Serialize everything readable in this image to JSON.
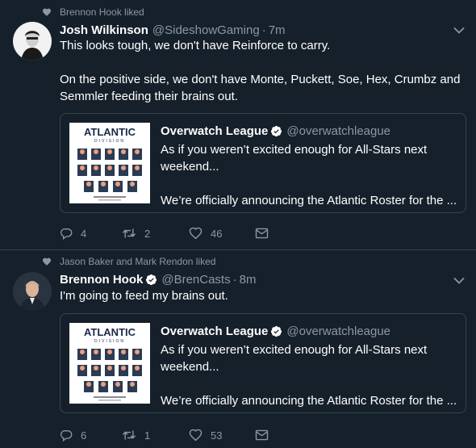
{
  "tweets": [
    {
      "social_context": "Brennon Hook liked",
      "author": {
        "display_name": "Josh Wilkinson",
        "handle": "@SideshowGaming",
        "verified": false
      },
      "time": "7m",
      "text": [
        "This looks tough, we don't have Reinforce to carry.",
        "On the positive side, we don't have Monte, Puckett, Soe, Hex, Crumbz and Semmler feeding their brains out."
      ],
      "quote": {
        "display_name": "Overwatch League",
        "handle": "@overwatchleague",
        "verified": true,
        "text": [
          "As if you weren’t excited enough for All-Stars next weekend...",
          "We’re officially announcing the Atlantic Roster for the ..."
        ],
        "thumbnail": {
          "title": "ATLANTIC",
          "subtitle": "DIVISION"
        }
      },
      "actions": {
        "replies": "4",
        "retweets": "2",
        "likes": "46"
      }
    },
    {
      "social_context": "Jason Baker and Mark Rendon liked",
      "author": {
        "display_name": "Brennon Hook",
        "handle": "@BrenCasts",
        "verified": true
      },
      "time": "8m",
      "text": [
        "I'm going to feed my brains out."
      ],
      "quote": {
        "display_name": "Overwatch League",
        "handle": "@overwatchleague",
        "verified": true,
        "text": [
          "As if you weren’t excited enough for All-Stars next weekend...",
          "We’re officially announcing the Atlantic Roster for the ..."
        ],
        "thumbnail": {
          "title": "ATLANTIC",
          "subtitle": "DIVISION"
        }
      },
      "actions": {
        "replies": "6",
        "retweets": "1",
        "likes": "53"
      }
    }
  ],
  "colors": {
    "background": "#15202b",
    "secondary_text": "#8899a6",
    "border": "#38444d",
    "verified": "#ffffff"
  },
  "icons": {
    "social": "heart-icon",
    "menu": "chevron-down-icon",
    "reply": "reply-icon",
    "retweet": "retweet-icon",
    "like": "heart-icon",
    "dm": "envelope-icon"
  }
}
